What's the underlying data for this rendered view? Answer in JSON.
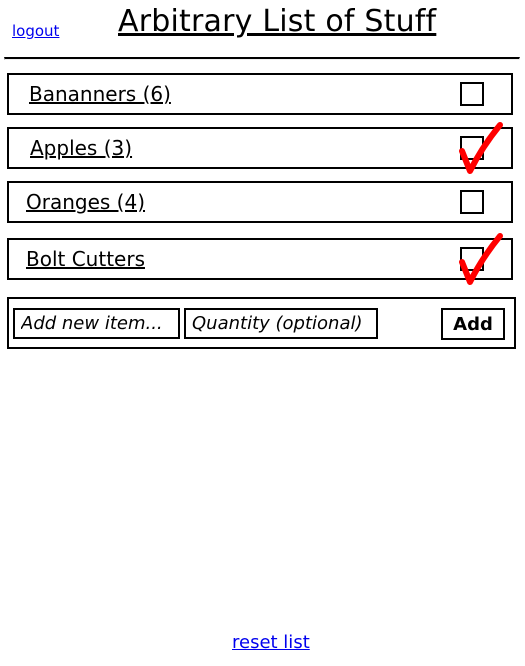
{
  "header": {
    "logout_label": "logout",
    "title": "Arbitrary List of Stuff"
  },
  "items": [
    {
      "label": "Bananners (6)",
      "checked": false
    },
    {
      "label": "Apples (3)",
      "checked": true
    },
    {
      "label": "Oranges (4)",
      "checked": false
    },
    {
      "label": "Bolt Cutters",
      "checked": true
    }
  ],
  "add_form": {
    "item_placeholder": "Add new item...",
    "quantity_placeholder": "Quantity (optional)",
    "add_label": "Add"
  },
  "footer": {
    "reset_label": "reset list"
  },
  "colors": {
    "link": "#0000ee",
    "check_mark": "#ff0000"
  }
}
